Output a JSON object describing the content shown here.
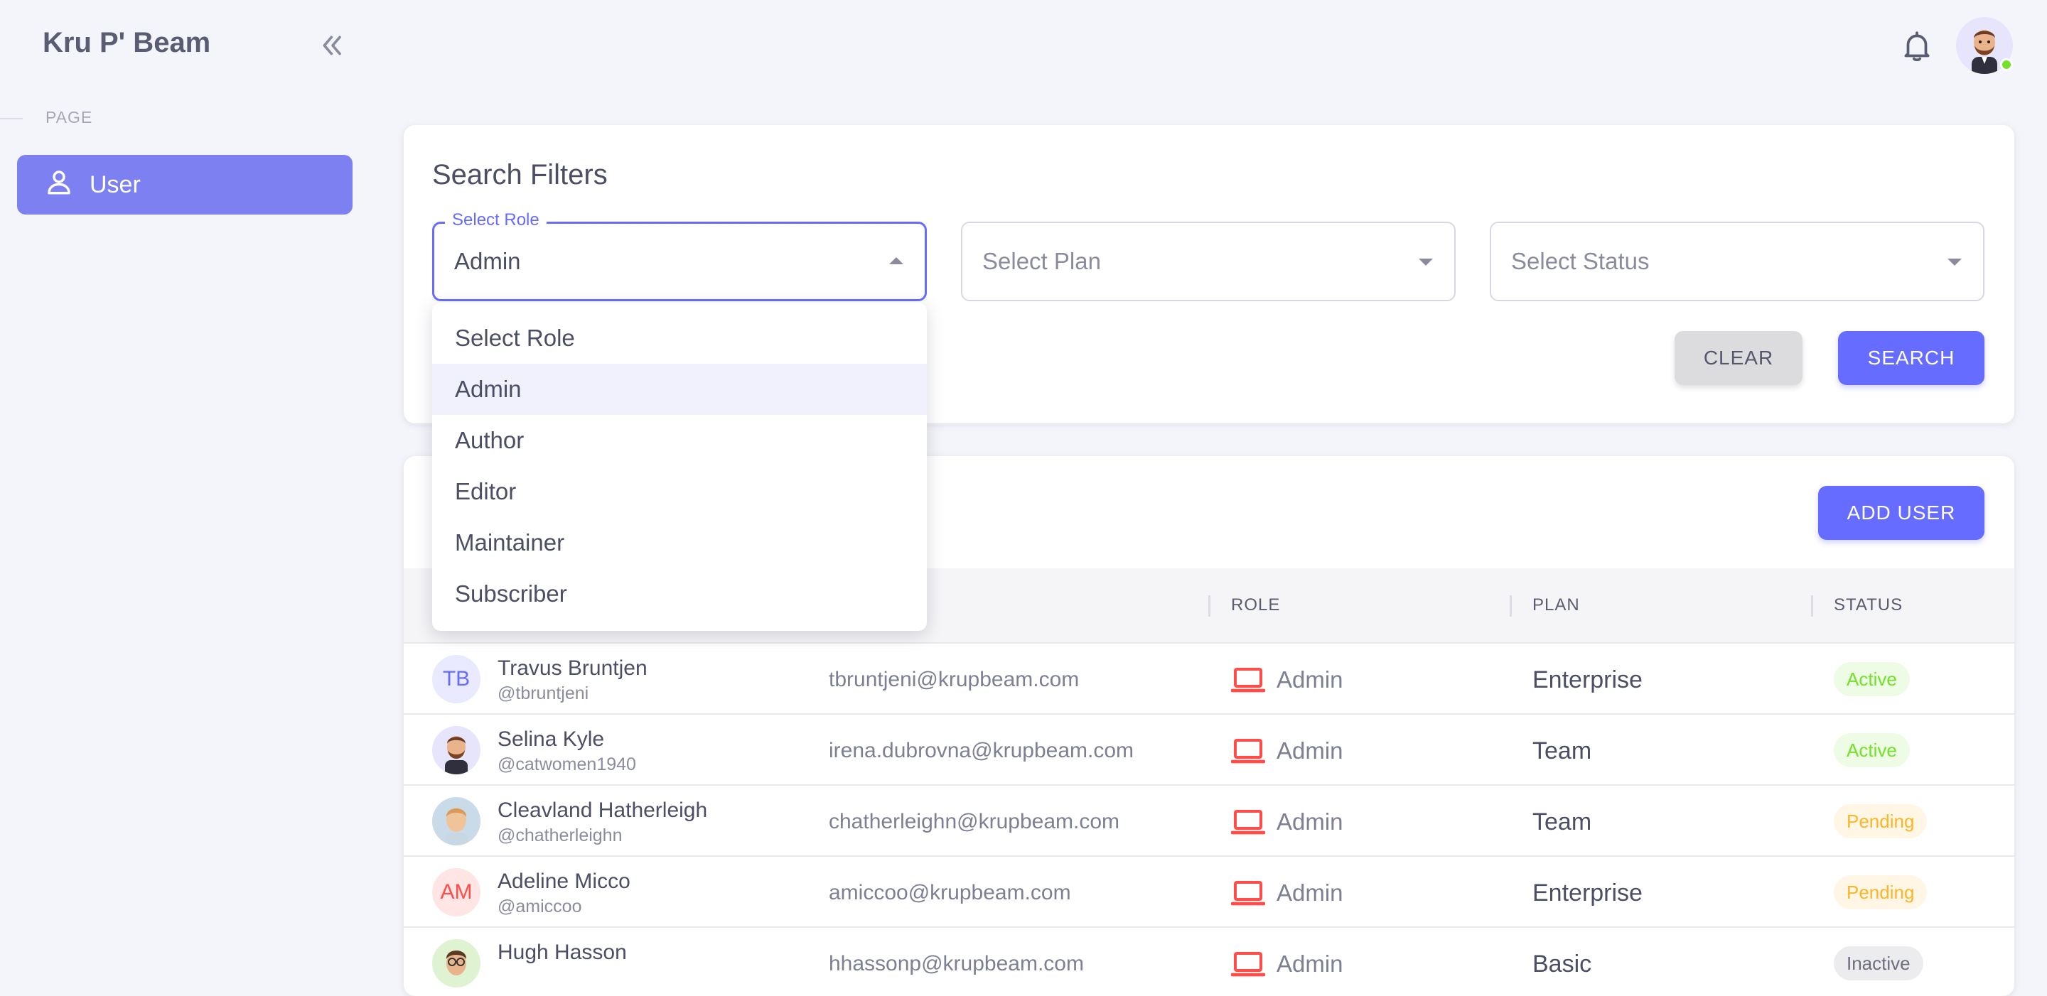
{
  "app": {
    "title": "Kru P' Beam"
  },
  "sidebar": {
    "section_label": "PAGE",
    "items": [
      {
        "label": "User",
        "icon": "user-icon"
      }
    ]
  },
  "filters": {
    "title": "Search Filters",
    "role": {
      "label": "Select Role",
      "value": "Admin",
      "options": [
        "Select Role",
        "Admin",
        "Author",
        "Editor",
        "Maintainer",
        "Subscriber"
      ]
    },
    "plan": {
      "placeholder": "Select Plan"
    },
    "status": {
      "placeholder": "Select Status"
    },
    "clear_label": "CLEAR",
    "search_label": "SEARCH"
  },
  "users": {
    "add_label": "ADD USER",
    "columns": {
      "role": "ROLE",
      "plan": "PLAN",
      "status": "STATUS"
    },
    "rows": [
      {
        "initials": "TB",
        "name": "Travus Bruntjen",
        "handle": "@tbruntjeni",
        "email": "tbruntjeni@krupbeam.com",
        "role": "Admin",
        "plan": "Enterprise",
        "status": "Active"
      },
      {
        "initials": "",
        "name": "Selina Kyle",
        "handle": "@catwomen1940",
        "email": "irena.dubrovna@krupbeam.com",
        "role": "Admin",
        "plan": "Team",
        "status": "Active"
      },
      {
        "initials": "",
        "name": "Cleavland Hatherleigh",
        "handle": "@chatherleighn",
        "email": "chatherleighn@krupbeam.com",
        "role": "Admin",
        "plan": "Team",
        "status": "Pending"
      },
      {
        "initials": "AM",
        "name": "Adeline Micco",
        "handle": "@amiccoo",
        "email": "amiccoo@krupbeam.com",
        "role": "Admin",
        "plan": "Enterprise",
        "status": "Pending"
      },
      {
        "initials": "",
        "name": "Hugh Hasson",
        "handle": "",
        "email": "hhassonp@krupbeam.com",
        "role": "Admin",
        "plan": "Basic",
        "status": "Inactive"
      }
    ]
  },
  "colors": {
    "primary": "#666cff",
    "active": "#72e128",
    "pending": "#fdb528",
    "role_icon": "#ff4d49"
  }
}
